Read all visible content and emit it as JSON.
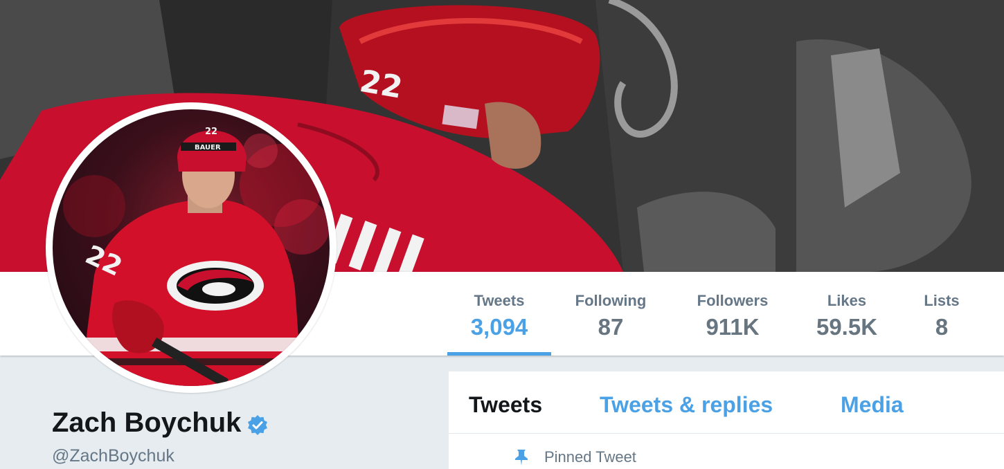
{
  "profile": {
    "name": "Zach Boychuk",
    "handle": "@ZachBoychuk",
    "verified": true,
    "accent_color": "#4ba1e6"
  },
  "stats": [
    {
      "label": "Tweets",
      "value": "3,094",
      "active": true
    },
    {
      "label": "Following",
      "value": "87",
      "active": false
    },
    {
      "label": "Followers",
      "value": "911K",
      "active": false
    },
    {
      "label": "Likes",
      "value": "59.5K",
      "active": false
    },
    {
      "label": "Lists",
      "value": "8",
      "active": false
    }
  ],
  "timeline": {
    "tabs": [
      {
        "label": "Tweets",
        "active": true
      },
      {
        "label": "Tweets & replies",
        "active": false
      },
      {
        "label": "Media",
        "active": false
      }
    ],
    "pinned_label": "Pinned Tweet"
  },
  "icons": {
    "verified": "verified-badge-icon",
    "pin": "pin-icon"
  }
}
